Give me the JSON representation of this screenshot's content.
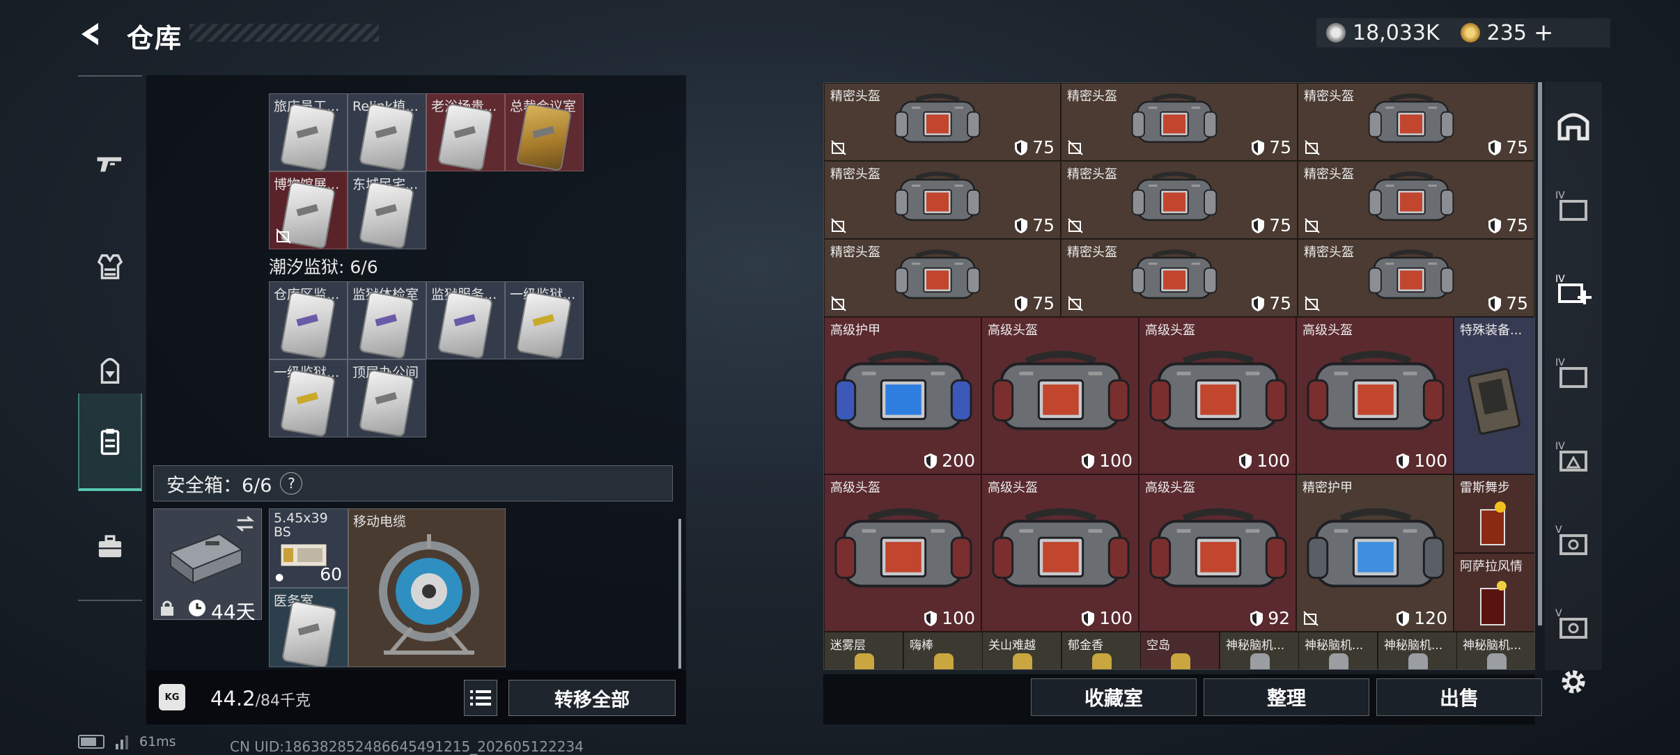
{
  "header": {
    "title": "仓库"
  },
  "currency": {
    "silver": "18,033K",
    "gold": "235",
    "add": "+"
  },
  "left_nav": {
    "items": [
      "weapons",
      "armor",
      "backpack",
      "storage",
      "case"
    ],
    "active": 3
  },
  "left_panel": {
    "top_row": [
      "旅店员工...",
      "Relink植...",
      "老浴场贵...",
      "总裁会议室"
    ],
    "second_row": [
      "博物馆展...",
      "东城民宅..."
    ],
    "prison_label": "潮汐监狱: 6/6",
    "prison_row1": [
      "仓库区监...",
      "监狱体检室",
      "监狱服务...",
      "一级监狱..."
    ],
    "prison_row2": [
      "一级监狱...",
      "顶层办公间"
    ],
    "safe_label": "安全箱：6/6",
    "safe_help": "?",
    "safe_time": "44天",
    "ammo_name": "5.45x39 BS",
    "ammo_count": "60",
    "cable_name": "移动电缆",
    "med_name": "医务室",
    "weight_current": "44.2",
    "weight_max": "/84千克",
    "kg_icon": "KG",
    "transfer_label": "转移全部"
  },
  "right_panel": {
    "precision_helmets": [
      {
        "name": "精密头盔",
        "value": "75"
      },
      {
        "name": "精密头盔",
        "value": "75"
      },
      {
        "name": "精密头盔",
        "value": "75"
      },
      {
        "name": "精密头盔",
        "value": "75"
      },
      {
        "name": "精密头盔",
        "value": "75"
      },
      {
        "name": "精密头盔",
        "value": "75"
      },
      {
        "name": "精密头盔",
        "value": "75"
      },
      {
        "name": "精密头盔",
        "value": "75"
      },
      {
        "name": "精密头盔",
        "value": "75"
      }
    ],
    "row4": [
      {
        "name": "高级护甲",
        "value": "200"
      },
      {
        "name": "高级头盔",
        "value": "100"
      },
      {
        "name": "高级头盔",
        "value": "100"
      },
      {
        "name": "高级头盔",
        "value": "100"
      }
    ],
    "special_name": "特殊装备...",
    "row5": [
      {
        "name": "高级头盔",
        "value": "100"
      },
      {
        "name": "高级头盔",
        "value": "100"
      },
      {
        "name": "高级头盔",
        "value": "92"
      },
      {
        "name": "精密护甲",
        "value": "120"
      }
    ],
    "drink1": "雷斯舞步",
    "drink2": "阿萨拉风情",
    "bottom_row": [
      "迷雾层",
      "嗨棒",
      "关山难越",
      "郁金香",
      "空岛",
      "神秘脑机...",
      "神秘脑机...",
      "神秘脑机...",
      "神秘脑机..."
    ],
    "collection_label": "收藏室",
    "sort_label": "整理",
    "sell_label": "出售"
  },
  "status": {
    "ping": "61ms",
    "uid": "CN UID:18638285248664549121​5_202605122234"
  },
  "colors": {
    "accent": "#58c7b0",
    "gray_cell": "#343c4b",
    "red_cell": "#5f2a30",
    "brown_cell": "#4a3b31"
  }
}
